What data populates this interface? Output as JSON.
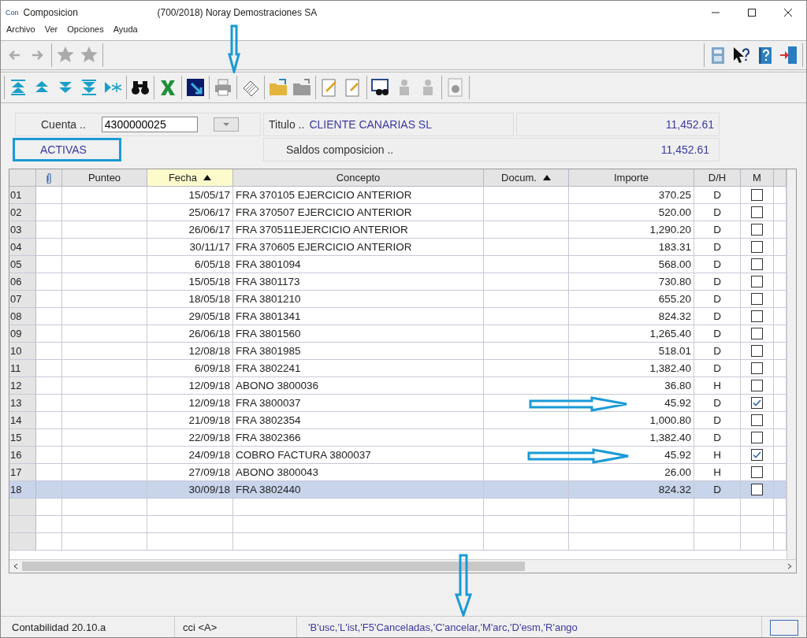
{
  "window": {
    "app_icon": "Con",
    "title": "Composicion",
    "company": "(700/2018) Noray Demostraciones SA"
  },
  "menu": [
    "Archivo",
    "Ver",
    "Opciones",
    "Ayuda"
  ],
  "header": {
    "cuenta_label": "Cuenta ..",
    "cuenta_value": "4300000025",
    "titulo_label": "Titulo ..",
    "titulo_value": "CLIENTE CANARIAS SL",
    "titulo_amount": "11,452.61",
    "filter": "ACTIVAS",
    "saldos_label": "Saldos composicion ..",
    "saldos_amount": "11,452.61"
  },
  "table": {
    "columns": [
      {
        "kind": "num"
      },
      {
        "kind": "clip"
      },
      {
        "label": "Punteo",
        "kind": "text"
      },
      {
        "label": "Fecha",
        "kind": "sort",
        "highlight": true
      },
      {
        "label": "Concepto",
        "kind": "text"
      },
      {
        "label": "Docum.",
        "kind": "sort",
        "highlight": false
      },
      {
        "label": "Importe",
        "kind": "text"
      },
      {
        "label": "D/H",
        "kind": "text"
      },
      {
        "label": "M",
        "kind": "text"
      }
    ],
    "rows": [
      {
        "n": "01",
        "fecha": "15/05/17",
        "concepto": "FRA 370105 EJERCICIO ANTERIOR",
        "importe": "370.25",
        "dh": "D",
        "checked": false,
        "selected": false
      },
      {
        "n": "02",
        "fecha": "25/06/17",
        "concepto": "FRA 370507 EJERCICIO ANTERIOR",
        "importe": "520.00",
        "dh": "D",
        "checked": false,
        "selected": false
      },
      {
        "n": "03",
        "fecha": "26/06/17",
        "concepto": "FRA 370511EJERCICIO ANTERIOR",
        "importe": "1,290.20",
        "dh": "D",
        "checked": false,
        "selected": false
      },
      {
        "n": "04",
        "fecha": "30/11/17",
        "concepto": "FRA 370605 EJERCICIO ANTERIOR",
        "importe": "183.31",
        "dh": "D",
        "checked": false,
        "selected": false
      },
      {
        "n": "05",
        "fecha": "6/05/18",
        "concepto": "FRA 3801094",
        "importe": "568.00",
        "dh": "D",
        "checked": false,
        "selected": false
      },
      {
        "n": "06",
        "fecha": "15/05/18",
        "concepto": "FRA 3801173",
        "importe": "730.80",
        "dh": "D",
        "checked": false,
        "selected": false
      },
      {
        "n": "07",
        "fecha": "18/05/18",
        "concepto": "FRA 3801210",
        "importe": "655.20",
        "dh": "D",
        "checked": false,
        "selected": false
      },
      {
        "n": "08",
        "fecha": "29/05/18",
        "concepto": "FRA 3801341",
        "importe": "824.32",
        "dh": "D",
        "checked": false,
        "selected": false
      },
      {
        "n": "09",
        "fecha": "26/06/18",
        "concepto": "FRA 3801560",
        "importe": "1,265.40",
        "dh": "D",
        "checked": false,
        "selected": false
      },
      {
        "n": "10",
        "fecha": "12/08/18",
        "concepto": "FRA 3801985",
        "importe": "518.01",
        "dh": "D",
        "checked": false,
        "selected": false
      },
      {
        "n": "11",
        "fecha": "6/09/18",
        "concepto": "FRA 3802241",
        "importe": "1,382.40",
        "dh": "D",
        "checked": false,
        "selected": false
      },
      {
        "n": "12",
        "fecha": "12/09/18",
        "concepto": "ABONO 3800036",
        "importe": "36.80",
        "dh": "H",
        "checked": false,
        "selected": false
      },
      {
        "n": "13",
        "fecha": "12/09/18",
        "concepto": "FRA 3800037",
        "importe": "45.92",
        "dh": "D",
        "checked": true,
        "selected": false
      },
      {
        "n": "14",
        "fecha": "21/09/18",
        "concepto": "FRA 3802354",
        "importe": "1,000.80",
        "dh": "D",
        "checked": false,
        "selected": false
      },
      {
        "n": "15",
        "fecha": "22/09/18",
        "concepto": "FRA 3802366",
        "importe": "1,382.40",
        "dh": "D",
        "checked": false,
        "selected": false
      },
      {
        "n": "16",
        "fecha": "24/09/18",
        "concepto": "COBRO FACTURA 3800037",
        "importe": "45.92",
        "dh": "H",
        "checked": true,
        "selected": false
      },
      {
        "n": "17",
        "fecha": "27/09/18",
        "concepto": "ABONO 3800043",
        "importe": "26.00",
        "dh": "H",
        "checked": false,
        "selected": false
      },
      {
        "n": "18",
        "fecha": "30/09/18",
        "concepto": "FRA 3802440",
        "importe": "824.32",
        "dh": "D",
        "checked": false,
        "selected": true
      }
    ]
  },
  "status_bar": [
    "Contabilidad 20.10.a",
    "cci <A>",
    "'B'usc,'L'ist,'F5'Canceladas,'C'ancelar,'M'arc,'D'esm,'R'ango"
  ]
}
